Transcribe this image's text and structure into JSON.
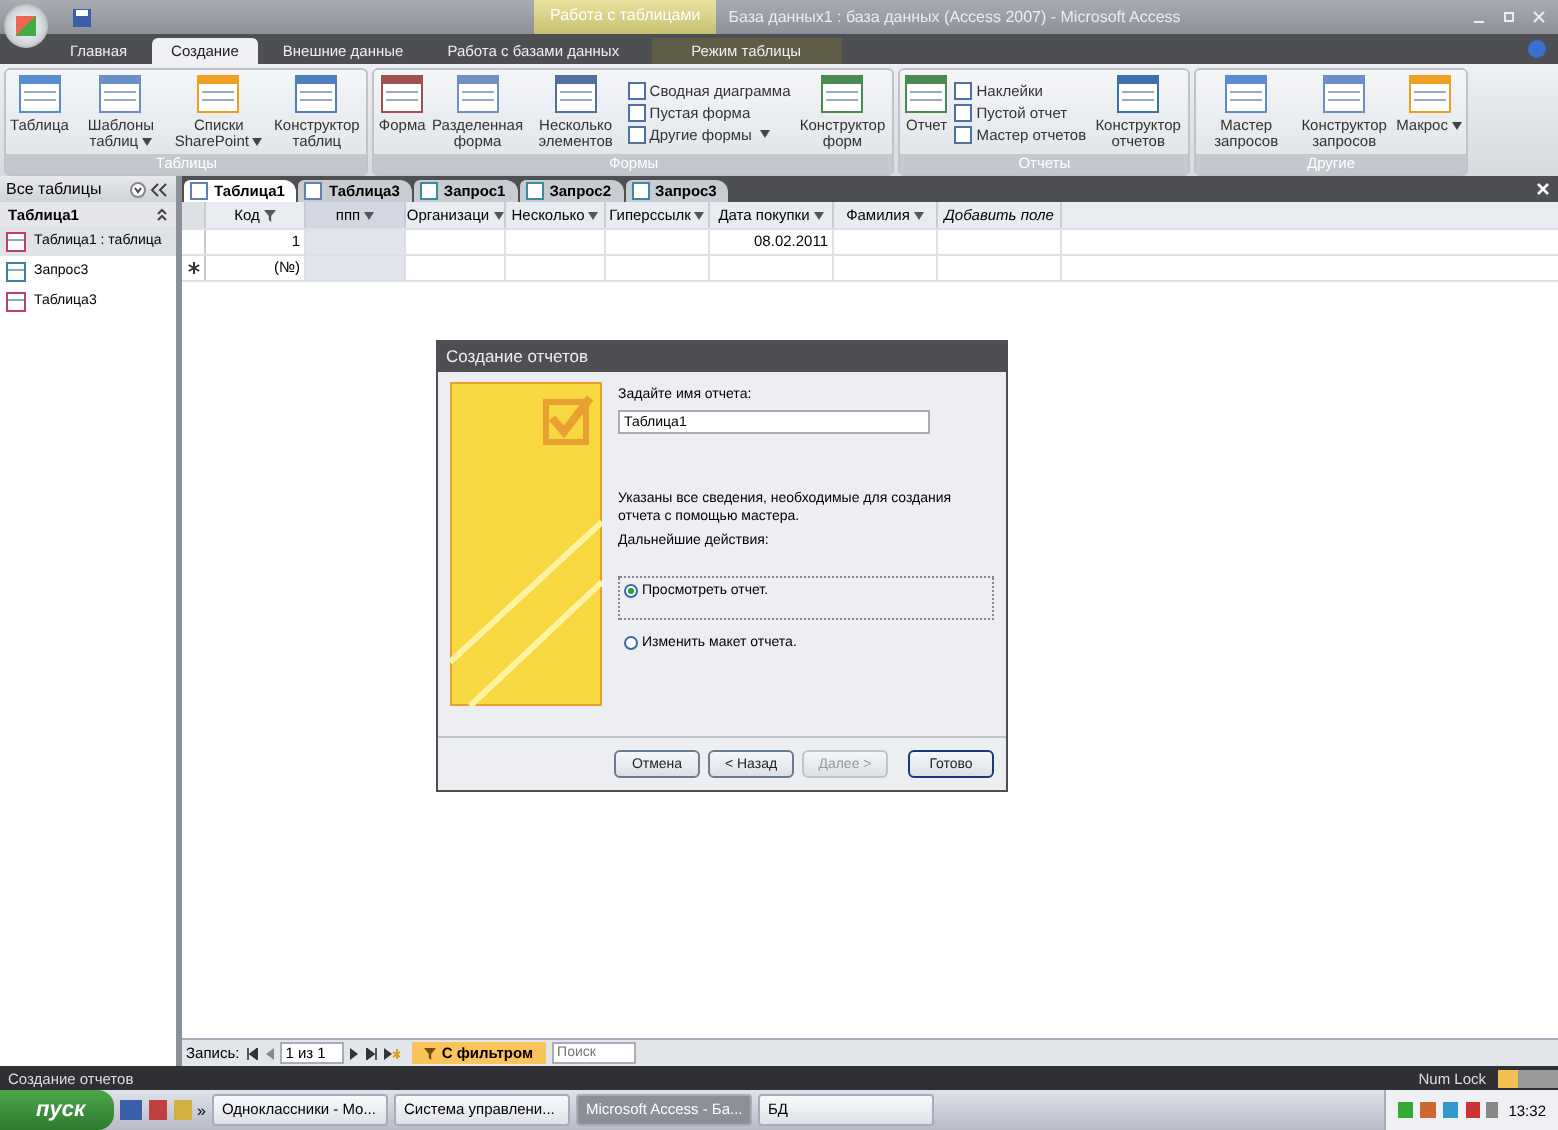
{
  "title_bar": {
    "context_tab": "Работа с таблицами",
    "title": "База данных1 : база данных (Access 2007) - Microsoft Access"
  },
  "ribbon_tabs": [
    {
      "label": "Главная",
      "selected": false,
      "contextual": false
    },
    {
      "label": "Создание",
      "selected": true,
      "contextual": false
    },
    {
      "label": "Внешние данные",
      "selected": false,
      "contextual": false
    },
    {
      "label": "Работа с базами данных",
      "selected": false,
      "contextual": false
    },
    {
      "label": "Режим таблицы",
      "selected": false,
      "contextual": true
    }
  ],
  "ribbon_groups": [
    {
      "title": "Таблицы",
      "items": [
        {
          "kind": "large",
          "label": "Таблица",
          "dropdown": false
        },
        {
          "kind": "large",
          "label": "Шаблоны таблиц",
          "dropdown": true
        },
        {
          "kind": "large",
          "label": "Списки SharePoint",
          "dropdown": true
        },
        {
          "kind": "large",
          "label": "Конструктор таблиц",
          "dropdown": false
        }
      ]
    },
    {
      "title": "Формы",
      "items": [
        {
          "kind": "large",
          "label": "Форма",
          "dropdown": false
        },
        {
          "kind": "large",
          "label": "Разделенная форма",
          "dropdown": false
        },
        {
          "kind": "large",
          "label": "Несколько элементов",
          "dropdown": false
        },
        {
          "kind": "stack",
          "items": [
            {
              "label": "Сводная диаграмма",
              "dropdown": false
            },
            {
              "label": "Пустая форма",
              "dropdown": false
            },
            {
              "label": "Другие формы",
              "dropdown": true
            }
          ]
        },
        {
          "kind": "large",
          "label": "Конструктор форм",
          "dropdown": false
        }
      ]
    },
    {
      "title": "Отчеты",
      "items": [
        {
          "kind": "large",
          "label": "Отчет",
          "dropdown": false
        },
        {
          "kind": "stack",
          "items": [
            {
              "label": "Наклейки",
              "dropdown": false
            },
            {
              "label": "Пустой отчет",
              "dropdown": false
            },
            {
              "label": "Мастер отчетов",
              "dropdown": false
            }
          ]
        },
        {
          "kind": "large",
          "label": "Конструктор отчетов",
          "dropdown": false
        }
      ]
    },
    {
      "title": "Другие",
      "items": [
        {
          "kind": "large",
          "label": "Мастер запросов",
          "dropdown": false
        },
        {
          "kind": "large",
          "label": "Конструктор запросов",
          "dropdown": false
        },
        {
          "kind": "large",
          "label": "Макрос",
          "dropdown": true
        }
      ]
    }
  ],
  "nav_pane": {
    "header": "Все таблицы",
    "group": "Таблица1",
    "items": [
      {
        "label": "Таблица1 : таблица",
        "selected": true,
        "kind": "table"
      },
      {
        "label": "Запрос3",
        "selected": false,
        "kind": "query"
      },
      {
        "label": "Таблица3",
        "selected": false,
        "kind": "table"
      }
    ]
  },
  "doc_tabs": [
    {
      "label": "Таблица1",
      "selected": true,
      "kind": "table"
    },
    {
      "label": "Таблица3",
      "selected": false,
      "kind": "table"
    },
    {
      "label": "Запрос1",
      "selected": false,
      "kind": "query"
    },
    {
      "label": "Запрос2",
      "selected": false,
      "kind": "query"
    },
    {
      "label": "Запрос3",
      "selected": false,
      "kind": "query"
    }
  ],
  "table": {
    "columns": [
      {
        "label": "Код",
        "selected": false,
        "kind": "filtered"
      },
      {
        "label": "ппп",
        "selected": true,
        "kind": "field"
      },
      {
        "label": "Организаци",
        "selected": false,
        "kind": "field"
      },
      {
        "label": "Несколько",
        "selected": false,
        "kind": "field"
      },
      {
        "label": "Гиперссылк",
        "selected": false,
        "kind": "field"
      },
      {
        "label": "Дата покупки",
        "selected": false,
        "kind": "field"
      },
      {
        "label": "Фамилия",
        "selected": false,
        "kind": "field"
      },
      {
        "label": "Добавить поле",
        "selected": false,
        "kind": "add"
      }
    ],
    "rows": [
      {
        "new": false,
        "cells": [
          "1",
          "",
          "",
          "",
          "",
          "08.02.2011",
          "",
          ""
        ]
      },
      {
        "new": true,
        "cells": [
          "(№)",
          "",
          "",
          "",
          "",
          "",
          "",
          ""
        ]
      }
    ]
  },
  "dialog": {
    "title": "Создание отчетов",
    "name_label": "Задайте имя отчета:",
    "name_value": "Таблица1",
    "info": "Указаны все сведения, необходимые для создания отчета с помощью мастера.",
    "next_label": "Дальнейшие действия:",
    "options": [
      {
        "label": "Просмотреть отчет.",
        "selected": true
      },
      {
        "label": "Изменить макет отчета.",
        "selected": false
      }
    ],
    "buttons": [
      {
        "label": "Отмена",
        "disabled": false,
        "default": false
      },
      {
        "label": "< Назад",
        "disabled": false,
        "default": false
      },
      {
        "label": "Далее >",
        "disabled": true,
        "default": false
      },
      {
        "label": "Готово",
        "disabled": false,
        "default": true
      }
    ]
  },
  "record_nav": {
    "label": "Запись:",
    "position": "1 из 1",
    "filter": "С фильтром",
    "search_placeholder": "Поиск"
  },
  "status_bar": {
    "text": "Создание отчетов",
    "num_lock": "Num Lock"
  },
  "taskbar": {
    "start": "пуск",
    "chevron": "»",
    "tasks": [
      {
        "label": "Одноклассники - Мо...",
        "selected": false
      },
      {
        "label": "Система управлени...",
        "selected": false
      },
      {
        "label": "Microsoft Access - Ба...",
        "selected": true
      },
      {
        "label": "БД",
        "selected": false
      }
    ],
    "clock": "13:32"
  }
}
